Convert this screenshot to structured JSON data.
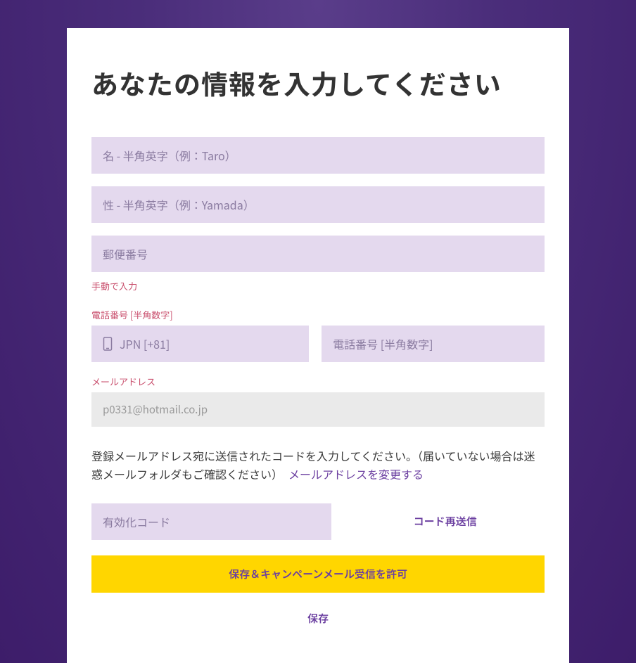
{
  "title": "あなたの情報を入力してください",
  "firstName": {
    "placeholder": "名 - 半角英字（例：Taro）"
  },
  "lastName": {
    "placeholder": "性 - 半角英字（例：Yamada）"
  },
  "postalCode": {
    "placeholder": "郵便番号"
  },
  "manualInput": "手動で入力",
  "phone": {
    "label": "電話番号 [半角数字]",
    "countryText": "JPN [+81]",
    "numberPlaceholder": "電話番号 [半角数字]"
  },
  "email": {
    "label": "メールアドレス",
    "value": "p0331@hotmail.co.jp"
  },
  "instruction": {
    "text": "登録メールアドレス宛に送信されたコードを入力してください。（届いていない場合は迷惑メールフォルダもご確認ください）　",
    "linkText": "メールアドレスを変更する"
  },
  "activationCode": {
    "placeholder": "有効化コード"
  },
  "resendCode": "コード再送信",
  "primaryButton": "保存＆キャンペーンメール受信を許可",
  "secondaryButton": "保存"
}
